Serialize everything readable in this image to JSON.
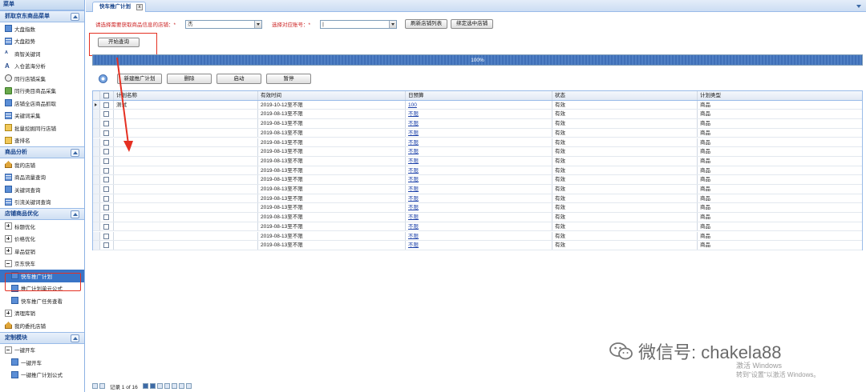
{
  "sidebar": {
    "title": "菜单",
    "sections": [
      {
        "title": "抓取京东商品菜单",
        "items": [
          {
            "label": "大盘指数",
            "icon": "chart-icon"
          },
          {
            "label": "大盘趋势",
            "icon": "trend-icon"
          },
          {
            "label": "商智关键词",
            "icon": "keyword-icon"
          },
          {
            "label": "入仓蓝海分析",
            "icon": "analysis-icon"
          },
          {
            "label": "同行店铺采集",
            "icon": "eye-icon"
          },
          {
            "label": "同行类目商品采集",
            "icon": "collect-icon"
          },
          {
            "label": "店铺全店商品抓取",
            "icon": "store-icon"
          },
          {
            "label": "关键词采集",
            "icon": "search-icon"
          },
          {
            "label": "批量挖掘同行店铺",
            "icon": "batch-icon"
          },
          {
            "label": "查排名",
            "icon": "rank-icon"
          }
        ]
      },
      {
        "title": "商品分析",
        "items": [
          {
            "label": "我的店铺",
            "icon": "home-icon"
          },
          {
            "label": "商品流量查询",
            "icon": "traffic-icon"
          },
          {
            "label": "关键词查询",
            "icon": "keyword-query-icon"
          },
          {
            "label": "引流关键词查询",
            "icon": "drain-keyword-icon"
          }
        ]
      },
      {
        "title": "店铺商品优化",
        "items": [
          {
            "label": "标题优化",
            "expander": "plus"
          },
          {
            "label": "价格优化",
            "expander": "plus"
          },
          {
            "label": "单品促销",
            "expander": "plus"
          },
          {
            "label": "京东快车",
            "expander": "minus"
          },
          {
            "label": "快车推广计划",
            "sub": true,
            "selected": true
          },
          {
            "label": "推广计划单元公式",
            "sub": true
          },
          {
            "label": "快车推广任务查看",
            "sub": true
          },
          {
            "label": "清理库销",
            "expander": "plus"
          },
          {
            "label": "我的委托店铺",
            "icon": "house-icon"
          }
        ]
      },
      {
        "title": "定制模块",
        "items": [
          {
            "label": "一键开车",
            "expander": "minus"
          },
          {
            "label": "一键开车",
            "sub": true
          },
          {
            "label": "一键推广计划公式",
            "sub": true
          }
        ]
      }
    ]
  },
  "tab": {
    "label": "快车推广计划",
    "close": "x"
  },
  "form": {
    "shop_label": "请选择需要获取商品信息的店铺：",
    "shop_required": "*",
    "shop_value": "杰",
    "account_label": "选择对应账号：",
    "account_required": "*",
    "account_value": "|",
    "refresh_shops": "刷新店铺列表",
    "bind_shop": "绑定选中店铺",
    "start_query": "开始查询"
  },
  "progress": {
    "value": 1.0,
    "text": "100%"
  },
  "toolbar": {
    "new": "新建推广计划",
    "delete": "删除",
    "start": "启动",
    "pause": "暂停"
  },
  "grid": {
    "columns": [
      "计划名称",
      "有效时间",
      "日预算",
      "状态",
      "计划类型"
    ],
    "rows": [
      {
        "name": "测试",
        "time": "2019-10-12至不限",
        "budget": "100",
        "status": "有效",
        "type": "商品"
      },
      {
        "name": "",
        "time": "2019-08-13至不限",
        "budget": "不限",
        "status": "有效",
        "type": "商品"
      },
      {
        "name": "",
        "time": "2019-08-13至不限",
        "budget": "不限",
        "status": "有效",
        "type": "商品"
      },
      {
        "name": "",
        "time": "2019-08-13至不限",
        "budget": "不限",
        "status": "有效",
        "type": "商品"
      },
      {
        "name": "",
        "time": "2019-08-13至不限",
        "budget": "不限",
        "status": "有效",
        "type": "商品"
      },
      {
        "name": "",
        "time": "2019-08-13至不限",
        "budget": "不限",
        "status": "有效",
        "type": "商品"
      },
      {
        "name": "",
        "time": "2019-08-13至不限",
        "budget": "不限",
        "status": "有效",
        "type": "商品"
      },
      {
        "name": "",
        "time": "2019-08-13至不限",
        "budget": "不限",
        "status": "有效",
        "type": "商品"
      },
      {
        "name": "",
        "time": "2019-08-13至不限",
        "budget": "不限",
        "status": "有效",
        "type": "商品"
      },
      {
        "name": "",
        "time": "2019-08-13至不限",
        "budget": "不限",
        "status": "有效",
        "type": "商品"
      },
      {
        "name": "",
        "time": "2019-08-13至不限",
        "budget": "不限",
        "status": "有效",
        "type": "商品"
      },
      {
        "name": "",
        "time": "2019-08-13至不限",
        "budget": "不限",
        "status": "有效",
        "type": "商品"
      },
      {
        "name": "",
        "time": "2019-08-13至不限",
        "budget": "不限",
        "status": "有效",
        "type": "商品"
      },
      {
        "name": "",
        "time": "2019-08-13至不限",
        "budget": "不限",
        "status": "有效",
        "type": "商品"
      },
      {
        "name": "",
        "time": "2019-08-13至不限",
        "budget": "不限",
        "status": "有效",
        "type": "商品"
      },
      {
        "name": "",
        "time": "2019-08-13至不限",
        "budget": "不限",
        "status": "有效",
        "type": "商品"
      }
    ]
  },
  "pager": {
    "record_text": "记录 1 of 16"
  },
  "watermark": {
    "text": "微信号: chakela88"
  },
  "activate": {
    "line1": "激活 Windows",
    "line2": "转到\"设置\"以激活 Windows。"
  },
  "colors": {
    "accent": "#3974c6",
    "annotation": "#e53022",
    "header_blue": "#15428b"
  }
}
